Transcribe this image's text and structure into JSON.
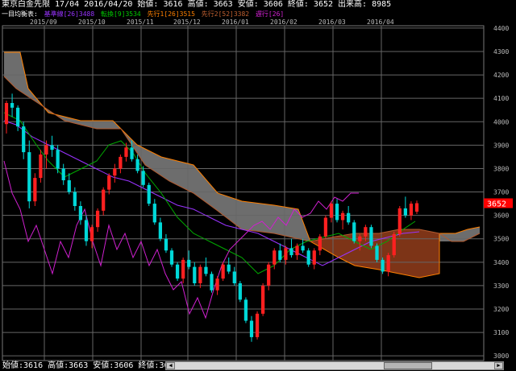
{
  "header": {
    "title": "東京白金先限",
    "contract": "17/04",
    "date": "2016/04/20",
    "open": "始値: 3616",
    "high": "高値: 3663",
    "low": "安値: 3606",
    "close": "終値: 3652",
    "volume": "出来高: 8985"
  },
  "legend": {
    "prefix": "一目均衡表:",
    "kijun": "基準線[26]3488",
    "tenkan": "転換[9]3534",
    "senko1": "先行1[26]3515",
    "senko2": "先行2[52]3382",
    "chikou": "遅行[26]"
  },
  "footer": {
    "open": "始値:3616",
    "high": "高値:3663",
    "low": "安値:3606",
    "close": "終値:3652"
  },
  "colors": {
    "up": "#ff2020",
    "down": "#00d8d8",
    "kijun": "#9933ff",
    "tenkan": "#00aa00",
    "senko1": "#ff8000",
    "senko2": "#b35a2e",
    "chikou": "#d020d0",
    "cloud_bear": "#808080",
    "cloud_bull": "#8b3a1a",
    "price_tag": "#ff0000"
  },
  "chart_data": {
    "type": "candlestick",
    "y_ticks": [
      "4400",
      "4300",
      "4200",
      "4100",
      "4000",
      "3900",
      "3800",
      "3700",
      "3600",
      "3500",
      "3400",
      "3300",
      "3200",
      "3100",
      "3000"
    ],
    "ylim": [
      2980,
      4410
    ],
    "x_ticks": [
      "2015/09",
      "2015/10",
      "2015/11",
      "2015/12",
      "2016/01",
      "2016/02",
      "2016/03",
      "2016/04"
    ],
    "last_price": "3652",
    "candles": [
      [
        3990,
        4090,
        3950,
        4080
      ],
      [
        4080,
        4120,
        4020,
        4060
      ],
      [
        4060,
        4070,
        3960,
        3980
      ],
      [
        3980,
        4000,
        3840,
        3870
      ],
      [
        3870,
        3920,
        3630,
        3660
      ],
      [
        3660,
        3780,
        3640,
        3760
      ],
      [
        3760,
        3880,
        3740,
        3860
      ],
      [
        3860,
        3920,
        3800,
        3900
      ],
      [
        3900,
        3940,
        3850,
        3880
      ],
      [
        3880,
        3900,
        3780,
        3800
      ],
      [
        3800,
        3820,
        3730,
        3750
      ],
      [
        3750,
        3780,
        3690,
        3700
      ],
      [
        3700,
        3720,
        3620,
        3640
      ],
      [
        3640,
        3660,
        3560,
        3580
      ],
      [
        3580,
        3600,
        3470,
        3490
      ],
      [
        3490,
        3560,
        3460,
        3550
      ],
      [
        3550,
        3630,
        3530,
        3620
      ],
      [
        3620,
        3720,
        3600,
        3710
      ],
      [
        3710,
        3780,
        3690,
        3770
      ],
      [
        3770,
        3820,
        3740,
        3800
      ],
      [
        3800,
        3860,
        3780,
        3850
      ],
      [
        3850,
        3910,
        3830,
        3890
      ],
      [
        3890,
        3920,
        3830,
        3840
      ],
      [
        3840,
        3860,
        3780,
        3790
      ],
      [
        3790,
        3810,
        3720,
        3730
      ],
      [
        3730,
        3740,
        3640,
        3650
      ],
      [
        3650,
        3670,
        3560,
        3570
      ],
      [
        3570,
        3590,
        3490,
        3500
      ],
      [
        3500,
        3520,
        3440,
        3450
      ],
      [
        3450,
        3460,
        3380,
        3390
      ],
      [
        3390,
        3400,
        3320,
        3330
      ],
      [
        3330,
        3420,
        3310,
        3410
      ],
      [
        3410,
        3450,
        3370,
        3380
      ],
      [
        3380,
        3400,
        3300,
        3310
      ],
      [
        3310,
        3390,
        3290,
        3380
      ],
      [
        3380,
        3420,
        3340,
        3350
      ],
      [
        3350,
        3360,
        3270,
        3280
      ],
      [
        3280,
        3340,
        3260,
        3330
      ],
      [
        3330,
        3400,
        3320,
        3390
      ],
      [
        3390,
        3420,
        3350,
        3360
      ],
      [
        3360,
        3380,
        3300,
        3310
      ],
      [
        3310,
        3320,
        3230,
        3240
      ],
      [
        3240,
        3250,
        3140,
        3150
      ],
      [
        3150,
        3170,
        3060,
        3080
      ],
      [
        3080,
        3190,
        3070,
        3180
      ],
      [
        3180,
        3310,
        3170,
        3300
      ],
      [
        3300,
        3400,
        3280,
        3390
      ],
      [
        3390,
        3460,
        3370,
        3450
      ],
      [
        3450,
        3480,
        3400,
        3410
      ],
      [
        3410,
        3470,
        3390,
        3460
      ],
      [
        3460,
        3500,
        3420,
        3430
      ],
      [
        3430,
        3480,
        3410,
        3470
      ],
      [
        3470,
        3500,
        3440,
        3450
      ],
      [
        3450,
        3460,
        3380,
        3390
      ],
      [
        3390,
        3460,
        3370,
        3450
      ],
      [
        3450,
        3520,
        3430,
        3510
      ],
      [
        3510,
        3600,
        3500,
        3590
      ],
      [
        3590,
        3660,
        3570,
        3650
      ],
      [
        3650,
        3670,
        3570,
        3580
      ],
      [
        3580,
        3620,
        3540,
        3610
      ],
      [
        3610,
        3640,
        3560,
        3570
      ],
      [
        3570,
        3580,
        3480,
        3490
      ],
      [
        3490,
        3520,
        3450,
        3510
      ],
      [
        3510,
        3560,
        3490,
        3550
      ],
      [
        3550,
        3560,
        3460,
        3470
      ],
      [
        3470,
        3480,
        3400,
        3410
      ],
      [
        3410,
        3420,
        3350,
        3360
      ],
      [
        3360,
        3440,
        3340,
        3430
      ],
      [
        3430,
        3530,
        3420,
        3520
      ],
      [
        3520,
        3640,
        3510,
        3630
      ],
      [
        3630,
        3680,
        3590,
        3600
      ],
      [
        3600,
        3660,
        3580,
        3650
      ],
      [
        3616,
        3663,
        3606,
        3652
      ]
    ]
  }
}
